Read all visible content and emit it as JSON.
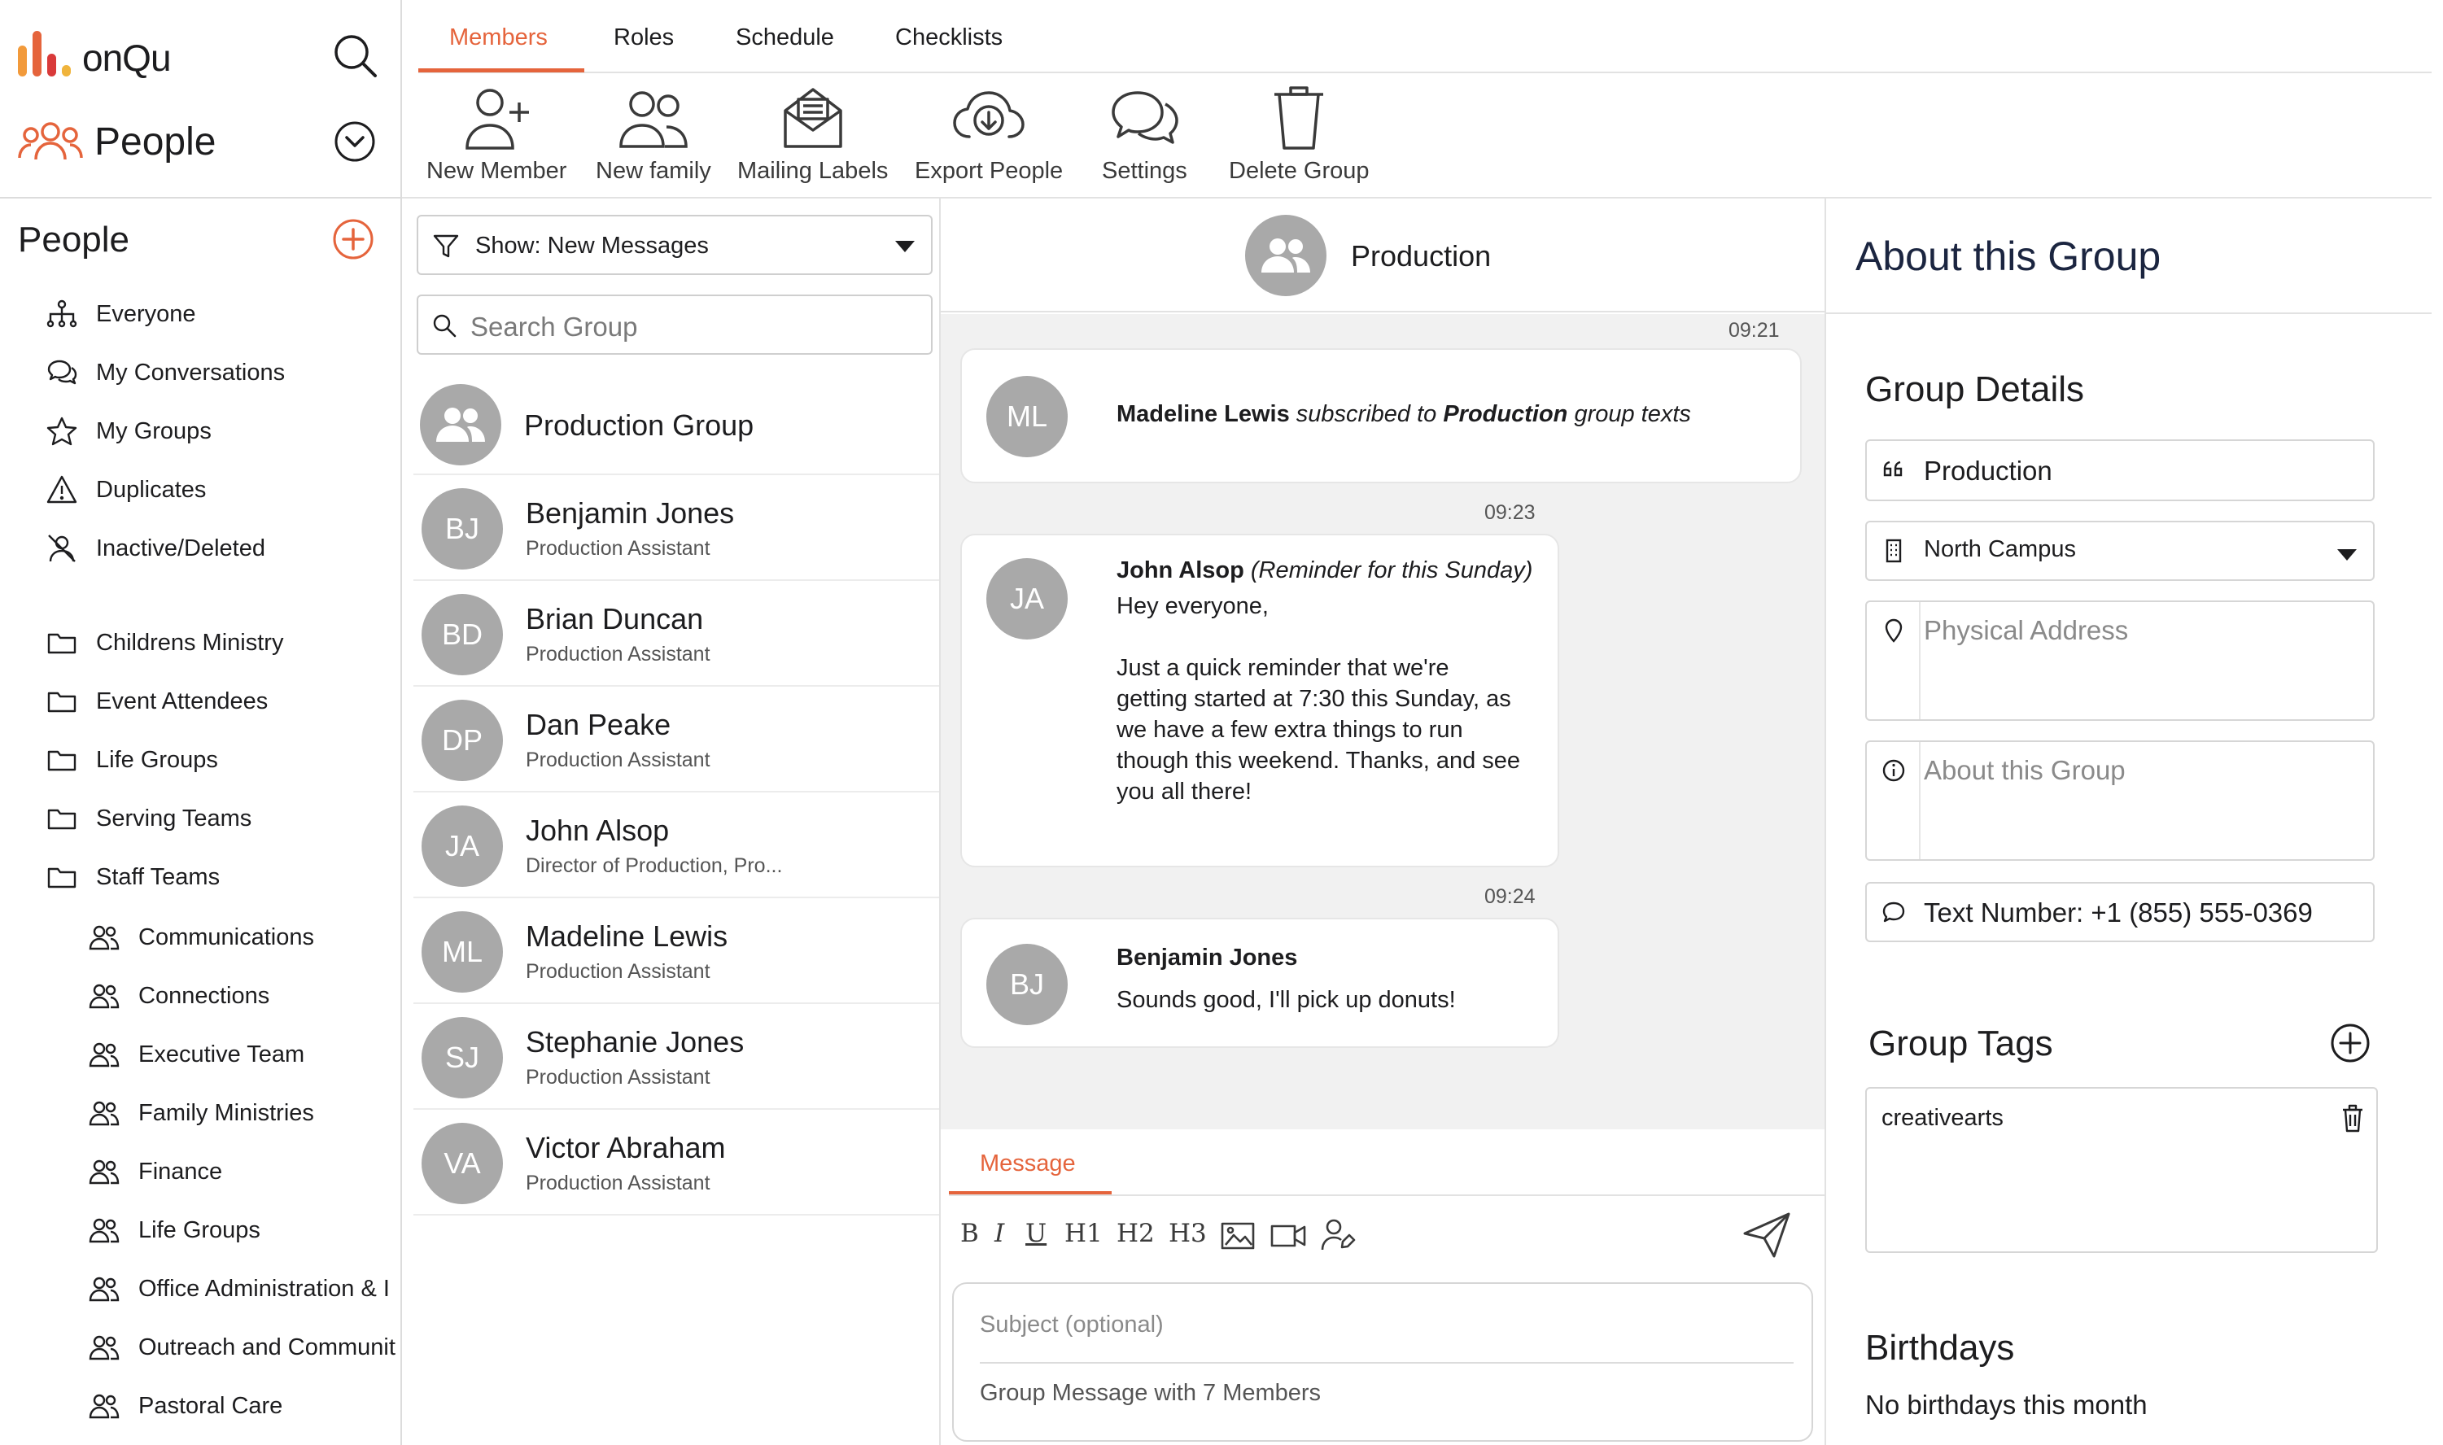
{
  "app": {
    "logo_text": "onQu",
    "module": "People"
  },
  "sidebar": {
    "heading": "People",
    "items": [
      {
        "label": "Everyone",
        "icon": "org-chart-icon"
      },
      {
        "label": "My Conversations",
        "icon": "conversations-icon"
      },
      {
        "label": "My Groups",
        "icon": "star-icon"
      },
      {
        "label": "Duplicates",
        "icon": "warning-icon"
      },
      {
        "label": "Inactive/Deleted",
        "icon": "person-off-icon"
      }
    ],
    "folders": [
      {
        "label": "Childrens Ministry"
      },
      {
        "label": "Event Attendees"
      },
      {
        "label": "Life Groups"
      },
      {
        "label": "Serving Teams"
      },
      {
        "label": "Staff Teams"
      }
    ],
    "staff_teams": [
      {
        "label": "Communications"
      },
      {
        "label": "Connections"
      },
      {
        "label": "Executive Team"
      },
      {
        "label": "Family Ministries"
      },
      {
        "label": "Finance"
      },
      {
        "label": "Life Groups"
      },
      {
        "label": "Office Administration & I"
      },
      {
        "label": "Outreach and Communit"
      },
      {
        "label": "Pastoral Care"
      }
    ]
  },
  "tabs": [
    {
      "label": "Members",
      "active": true
    },
    {
      "label": "Roles"
    },
    {
      "label": "Schedule"
    },
    {
      "label": "Checklists"
    }
  ],
  "toolbar": [
    {
      "label": "New Member",
      "icon": "add-person-icon"
    },
    {
      "label": "New family",
      "icon": "family-icon"
    },
    {
      "label": "Mailing Labels",
      "icon": "mail-icon"
    },
    {
      "label": "Export People",
      "icon": "cloud-download-icon"
    },
    {
      "label": "Settings",
      "icon": "chat-bubbles-icon"
    },
    {
      "label": "Delete Group",
      "icon": "trash-icon"
    }
  ],
  "members_panel": {
    "filter": "Show: New Messages",
    "search_placeholder": "Search Group",
    "group_row": "Production Group",
    "members": [
      {
        "initials": "BJ",
        "name": "Benjamin Jones",
        "role": "Production Assistant"
      },
      {
        "initials": "BD",
        "name": "Brian Duncan",
        "role": "Production Assistant"
      },
      {
        "initials": "DP",
        "name": "Dan Peake",
        "role": "Production Assistant"
      },
      {
        "initials": "JA",
        "name": "John Alsop",
        "role": "Director of Production, Pro..."
      },
      {
        "initials": "ML",
        "name": "Madeline Lewis",
        "role": "Production Assistant"
      },
      {
        "initials": "SJ",
        "name": "Stephanie Jones",
        "role": "Production Assistant"
      },
      {
        "initials": "VA",
        "name": "Victor Abraham",
        "role": "Production Assistant"
      }
    ]
  },
  "chat": {
    "group_name": "Production",
    "messages": [
      {
        "time": "09:21",
        "initials": "ML",
        "author": "Madeline Lewis",
        "text_a": " subscribed to ",
        "target": "Production",
        "text_b": " group texts"
      },
      {
        "time": "09:23",
        "initials": "JA",
        "author": "John Alsop",
        "note": " (Reminder for this Sunday)",
        "greeting": "Hey everyone,",
        "body_lines": [
          "Just a quick reminder that we're",
          "getting started at 7:30 this Sunday, as",
          "we have a few extra things to run",
          "though this weekend. Thanks, and see",
          "you all there!"
        ]
      },
      {
        "time": "09:24",
        "initials": "BJ",
        "author": "Benjamin Jones",
        "body": "Sounds good, I'll pick up donuts!"
      }
    ]
  },
  "composer": {
    "tab": "Message",
    "buttons": [
      "B",
      "I",
      "U",
      "H1",
      "H2",
      "H3"
    ],
    "subject_placeholder": "Subject (optional)",
    "message_placeholder": "Group Message with 7 Members"
  },
  "about": {
    "title": "About this Group",
    "details_title": "Group Details",
    "name": "Production",
    "campus": "North Campus",
    "address_placeholder": "Physical Address",
    "about_placeholder": "About this Group",
    "text_number": "Text Number: +1 (855) 555-0369",
    "tags_title": "Group Tags",
    "tags": [
      "creativearts"
    ],
    "birthdays_title": "Birthdays",
    "birthdays_empty": "No birthdays this month"
  },
  "colors": {
    "accent": "#e5643c",
    "avatar": "#a9a9a9",
    "navy": "#1b2540",
    "logo_bars": [
      "#f29a3b",
      "#e5643c",
      "#d93a3a",
      "#f0b43c"
    ]
  }
}
